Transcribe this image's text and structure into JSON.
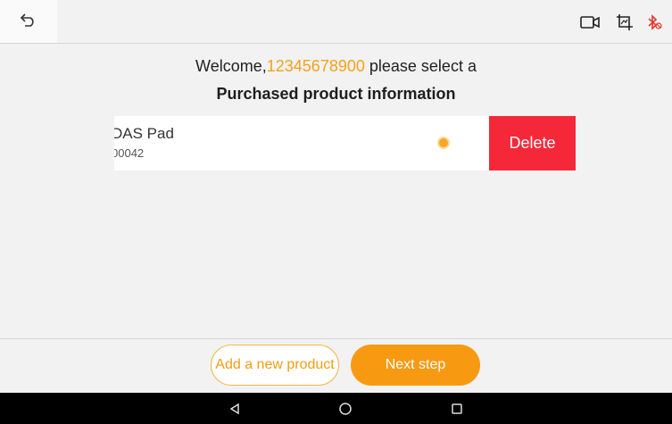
{
  "header": {
    "back_icon": "undo-arrow-icon",
    "icons": [
      "video-camera-icon",
      "screenshot-crop-icon",
      "bluetooth-disabled-icon"
    ],
    "bluetooth_color": "#e8342a"
  },
  "welcome": {
    "prefix": "Welcome,",
    "phone": "12345678900",
    "suffix": " please select a"
  },
  "subtitle": "Purchased product information",
  "products": [
    {
      "name": "DAS Pad",
      "serial": "00042",
      "selected": true
    }
  ],
  "actions": {
    "delete_label": "Delete",
    "add_product_label": "Add a new product",
    "next_step_label": "Next step"
  },
  "colors": {
    "accent": "#f79a12",
    "delete": "#f5283a"
  },
  "navbar": {
    "icons": [
      "back-triangle-icon",
      "home-circle-icon",
      "recents-square-icon"
    ]
  }
}
